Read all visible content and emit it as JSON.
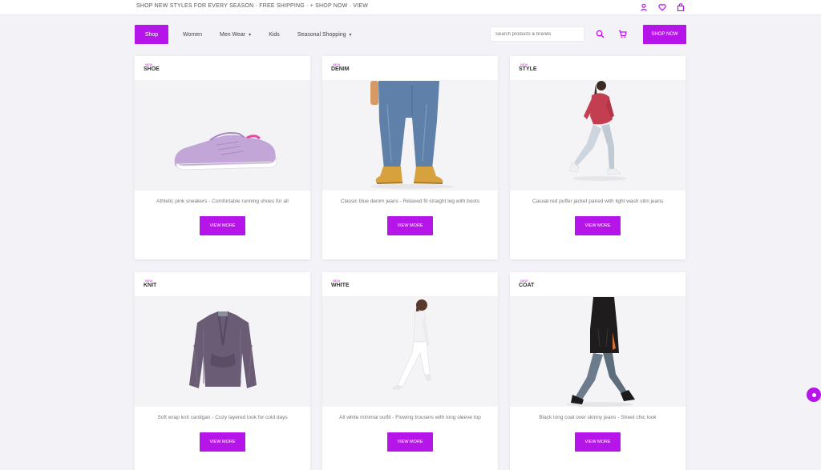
{
  "topbar": {
    "announcement": "SHOP NEW STYLES FOR EVERY SEASON · FREE SHIPPING · + SHOP NOW · VIEW",
    "icons": [
      "user-icon",
      "heart-icon",
      "bag-icon"
    ]
  },
  "nav": {
    "logo": "Shop",
    "links": [
      {
        "label": "Women",
        "has_caret": false
      },
      {
        "label": "Men Wear",
        "has_caret": true
      },
      {
        "label": "Kids",
        "has_caret": false
      },
      {
        "label": "Seasonal Shopping",
        "has_caret": true
      }
    ],
    "search_placeholder": "Search products & brands",
    "shop_button": "SHOP NOW"
  },
  "colors": {
    "accent": "#b515e8",
    "tag": "#d21fe0",
    "background": "#f3f2f6"
  },
  "cards": [
    {
      "tag": "NEW",
      "brand": "SHOE",
      "image": "sneaker",
      "desc": "Athletic pink sneakers - Comfortable running shoes for all",
      "button": "VIEW MORE"
    },
    {
      "tag": "NEW",
      "brand": "DENIM",
      "image": "jeans",
      "desc": "Classic blue denim jeans - Relaxed fit straight leg with boots",
      "button": "VIEW MORE"
    },
    {
      "tag": "NEW",
      "brand": "STYLE",
      "image": "walker-red",
      "desc": "Casual red puffer jacket paired with light wash slim jeans",
      "button": "VIEW MORE"
    },
    {
      "tag": "NEW",
      "brand": "KNIT",
      "image": "cardigan",
      "desc": "Soft wrap knit cardigan - Cozy layered look for cold days",
      "button": "VIEW MORE"
    },
    {
      "tag": "NEW",
      "brand": "WHITE",
      "image": "white-outfit",
      "desc": "All white minimal outfit - Flowing trousers with long sleeve top",
      "button": "VIEW MORE"
    },
    {
      "tag": "NEW",
      "brand": "COAT",
      "image": "walker-black",
      "desc": "Black long coat over skinny jeans - Street chic look",
      "button": "VIEW MORE"
    }
  ],
  "float_button_icon": "chat-icon"
}
